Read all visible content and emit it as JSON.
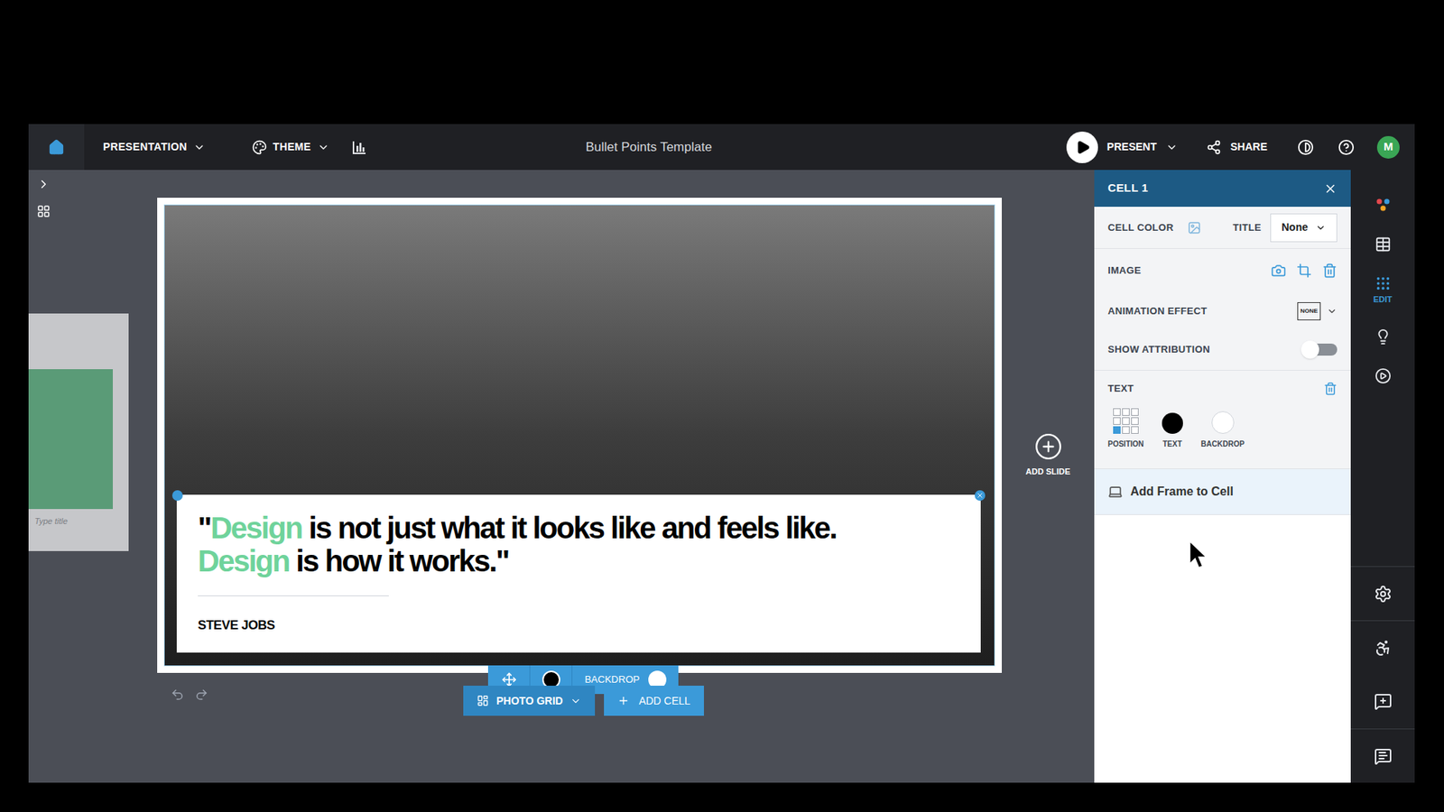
{
  "top_bar": {
    "menus": [
      {
        "label": "PRESENTATION"
      },
      {
        "label": "THEME"
      }
    ],
    "title": "Bullet Points Template",
    "present": "PRESENT",
    "share": "SHARE",
    "avatar": "M"
  },
  "thumbnail": {
    "title_placeholder": "Type title"
  },
  "slide": {
    "quote_lines": [
      [
        {
          "text": "\"",
          "highlight": false
        },
        {
          "text": "Design",
          "highlight": true
        },
        {
          "text": " is not just what it looks like and feels like.",
          "highlight": false
        }
      ],
      [
        {
          "text": "Design",
          "highlight": true
        },
        {
          "text": " is how it works.\"",
          "highlight": false
        }
      ]
    ],
    "author": "STEVE JOBS"
  },
  "cell_toolbar": {
    "text_color": "#000000",
    "backdrop_label": "BACKDROP",
    "backdrop_color": "#ffffff",
    "layout_button": "PHOTO GRID",
    "add_button": "ADD CELL"
  },
  "add_slide": "ADD SLIDE",
  "panel": {
    "title": "CELL 1",
    "cell_color_label": "CELL COLOR",
    "title_label": "TITLE",
    "title_value": "None",
    "image_label": "IMAGE",
    "animation_label": "ANIMATION EFFECT",
    "animation_value": "NONE",
    "attribution_label": "SHOW ATTRIBUTION",
    "attribution_on": false,
    "text_label": "TEXT",
    "position_label": "POSITION",
    "positions": [
      {
        "selected": false
      },
      {
        "selected": false
      },
      {
        "selected": false
      },
      {
        "selected": false
      },
      {
        "selected": false
      },
      {
        "selected": false
      },
      {
        "selected": true
      },
      {
        "selected": false
      },
      {
        "selected": false
      }
    ],
    "text_color_label": "TEXT",
    "text_color": "#000000",
    "backdrop_label": "BACKDROP",
    "backdrop_color": "#ffffff",
    "frame_button": "Add Frame to Cell"
  },
  "tool_rail": {
    "top": [
      {
        "selected": false
      },
      {
        "selected": false
      },
      {
        "label": "EDIT",
        "selected": true
      },
      {
        "selected": false
      },
      {
        "selected": false
      }
    ],
    "bottom": [
      {
        "selected": false
      },
      {
        "selected": false
      },
      {
        "selected": false
      },
      {
        "selected": false
      }
    ]
  }
}
